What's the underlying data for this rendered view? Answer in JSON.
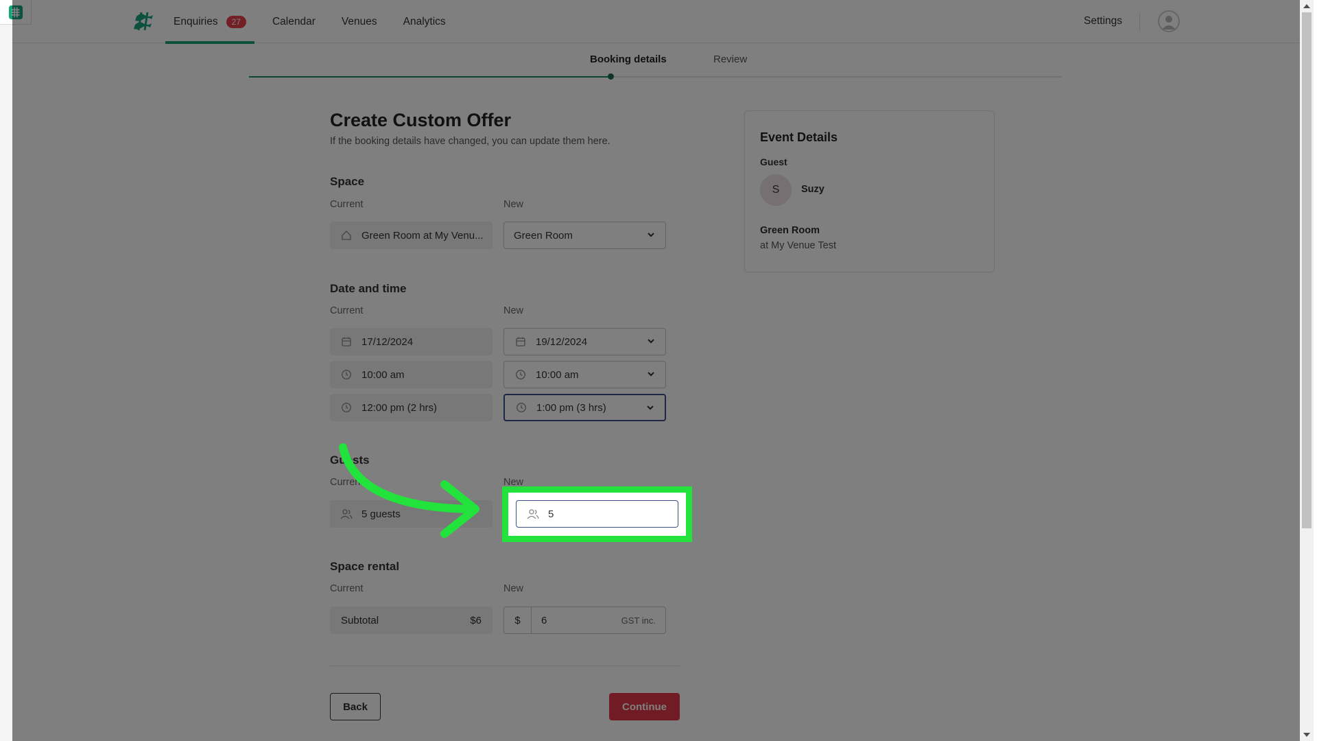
{
  "nav": {
    "items": [
      {
        "label": "Enquiries",
        "badge": "27"
      },
      {
        "label": "Calendar"
      },
      {
        "label": "Venues"
      },
      {
        "label": "Analytics"
      }
    ],
    "settings_label": "Settings"
  },
  "steps": {
    "booking_details": "Booking details",
    "review": "Review"
  },
  "form": {
    "title": "Create Custom Offer",
    "subtitle": "If the booking details have changed, you can update them here.",
    "current_label": "Current",
    "new_label": "New",
    "space": {
      "title": "Space",
      "current": "Green Room at My Venu...",
      "new": "Green Room"
    },
    "datetime": {
      "title": "Date and time",
      "current_date": "17/12/2024",
      "new_date": "19/12/2024",
      "current_start": "10:00 am",
      "new_start": "10:00 am",
      "current_end": "12:00 pm (2 hrs)",
      "new_end": "1:00 pm (3 hrs)"
    },
    "guests": {
      "title": "Guests",
      "current": "5 guests",
      "new": "5"
    },
    "rental": {
      "title": "Space rental",
      "subtotal_label": "Subtotal",
      "subtotal_value": "$6",
      "currency": "$",
      "new_value": "6",
      "gst": "GST inc."
    },
    "back_label": "Back",
    "continue_label": "Continue"
  },
  "event_card": {
    "title": "Event Details",
    "guest_label": "Guest",
    "guest_initial": "S",
    "guest_name": "Suzy",
    "room": "Green Room",
    "venue": "at My Venue Test"
  },
  "colors": {
    "accent": "#1aa377",
    "badge": "#e53e4b",
    "continue": "#e23849",
    "highlight": "#22e33b",
    "focus_border": "#3b4f88"
  }
}
